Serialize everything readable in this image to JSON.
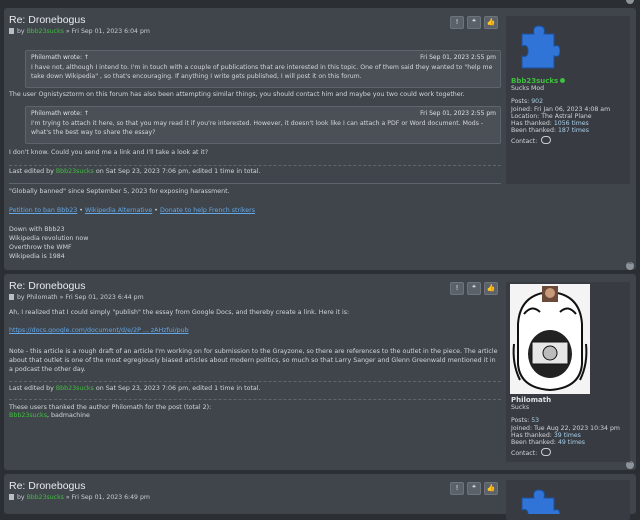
{
  "buttons": {
    "report": "!",
    "quote": "❝",
    "thanks": "👍"
  },
  "posts": [
    {
      "title": "Re: Dronebogus",
      "by": "by",
      "author": "Bbb23sucks",
      "date": "» Fri Sep 01, 2023 6:04 pm",
      "quote1": {
        "author": "Philomath wrote: ↑",
        "date": "Fri Sep 01, 2023 2:55 pm",
        "text": "I have not, although I intend to. I'm in touch with a couple of publications that are interested in this topic. One of them said they wanted to \"help me take down Wikipedia\" , so that's encouraging. If anything I write gets published, I will post it on this forum."
      },
      "para1": "The user Ognistysztorm on this forum has also been attempting similar things, you should contact him and maybe you two could work together.",
      "quote2": {
        "author": "Philomath wrote: ↑",
        "date": "Fri Sep 01, 2023 2:55 pm",
        "text": "I'm trying to attach it here, so that you may read it if you're interested. However, it doesn't look like I can attach a PDF or Word document. Mods - what's the best way to share the essay?"
      },
      "para2": "I don't know. Could you send me a link and I'll take a look at it?",
      "edit_prefix": "Last edited by",
      "edit_user": "Bbb23sucks",
      "edit_suffix": "on Sat Sep 23, 2023 7:06 pm, edited 1 time in total.",
      "sig_line1": "\"Globally banned\" since September 5, 2023 for exposing harassment.",
      "sig_links": [
        "Petition to ban Bbb23",
        "Wikipedia Alternative",
        "Donate to help French strikers"
      ],
      "sig_sep": "•",
      "sig_lines": [
        "Down with Bbb23",
        "Wikipedia revolution now",
        "Overthrow the WMF",
        "Wikipedia is 1984"
      ]
    },
    {
      "title": "Re: Dronebogus",
      "by": "by",
      "author": "Philomath",
      "date": "» Fri Sep 01, 2023 6:44 pm",
      "para1": "Ah, I realized that I could simply \"publish\" the essay from Google Docs, and thereby create a link. Here it is:",
      "link": "https://docs.google.com/document/d/e/2P ... zAHzfui/pub",
      "para2": "Note - this article is a rough draft of an article I'm working on for submission to the Grayzone, so there are references to the outlet in the piece. The article about that outlet is one of the most egregiously biased articles about modern politics, so much so that Larry Sanger and Glenn Greenwald mentioned it in a podcast the other day.",
      "edit_prefix": "Last edited by",
      "edit_user": "Bbb23sucks",
      "edit_suffix": "on Sat Sep 23, 2023 7:06 pm, edited 1 time in total.",
      "thanked_line": "These users thanked the author Philomath for the post (total 2):",
      "thanked_user1": "Bbb23sucks",
      "thanked_rest": ", badmachine"
    },
    {
      "title": "Re: Dronebogus",
      "by": "by",
      "author": "Bbb23sucks",
      "date": "» Fri Sep 01, 2023 6:49 pm"
    }
  ],
  "profiles": [
    {
      "name": "Bbb23sucks",
      "rank": "Sucks Mod",
      "posts_label": "Posts:",
      "posts": "902",
      "joined_label": "Joined:",
      "joined": "Fri Jan 06, 2023 4:08 am",
      "location_label": "Location:",
      "location": "The Astral Plane",
      "hasthanked_label": "Has thanked:",
      "hasthanked": "1056 times",
      "beenthanked_label": "Been thanked:",
      "beenthanked": "187 times",
      "contact_label": "Contact:",
      "avatar": "blue-puzzle-piece",
      "color": "#3fbf3f"
    },
    {
      "name": "Philomath",
      "rank": "Sucks",
      "posts_label": "Posts:",
      "posts": "53",
      "joined_label": "Joined:",
      "joined": "Tue Aug 22, 2023 10:34 pm",
      "hasthanked_label": "Has thanked:",
      "hasthanked": "39 times",
      "beenthanked_label": "Been thanked:",
      "beenthanked": "49 times",
      "contact_label": "Contact:",
      "avatar": "soyjak-drawing"
    }
  ]
}
